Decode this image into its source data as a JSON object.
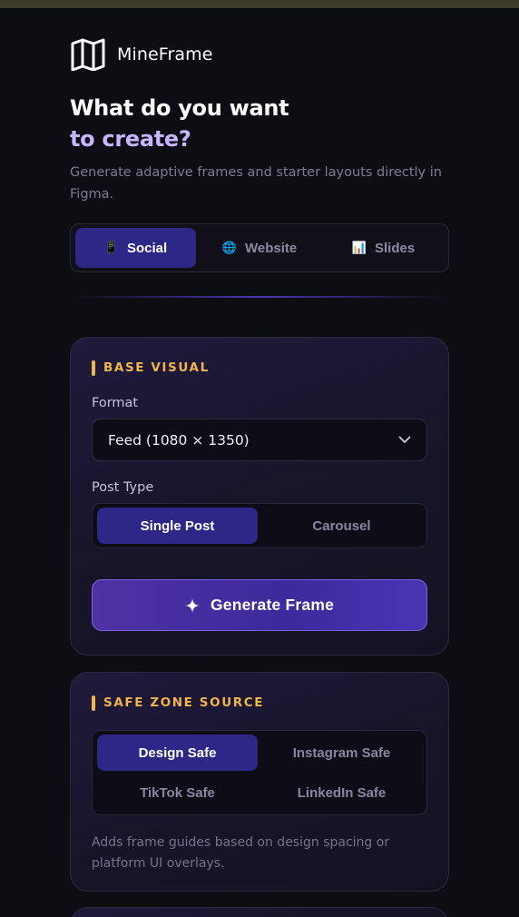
{
  "brand": {
    "name": "MineFrame",
    "logo_icon": "book-open-icon"
  },
  "headline": {
    "line1": "What do you want",
    "line2": "to create?"
  },
  "subtitle": "Generate adaptive frames and starter layouts directly in Figma.",
  "tabs": [
    {
      "label": "Social",
      "icon": "phone-icon",
      "icon_glyph": "📱",
      "active": true
    },
    {
      "label": "Website",
      "icon": "globe-icon",
      "icon_glyph": "🌐",
      "active": false
    },
    {
      "label": "Slides",
      "icon": "bar-chart-icon",
      "icon_glyph": "📊",
      "active": false
    }
  ],
  "base_visual": {
    "title": "BASE VISUAL",
    "format_label": "Format",
    "format_value": "Feed (1080 × 1350)",
    "post_type_label": "Post Type",
    "post_types": [
      {
        "label": "Single Post",
        "active": true
      },
      {
        "label": "Carousel",
        "active": false
      }
    ],
    "generate_label": "Generate Frame"
  },
  "safe_zone": {
    "title": "SAFE ZONE SOURCE",
    "options": [
      {
        "label": "Design Safe",
        "active": true
      },
      {
        "label": "Instagram Safe",
        "active": false
      },
      {
        "label": "TikTok Safe",
        "active": false
      },
      {
        "label": "LinkedIn Safe",
        "active": false
      }
    ],
    "helper": "Adds frame guides based on design spacing or platform UI overlays."
  },
  "colors": {
    "background": "#0d0d14",
    "accent": "#2d2787",
    "section_heading": "#f0b64d",
    "headline_accent": "#c9b4ff"
  }
}
